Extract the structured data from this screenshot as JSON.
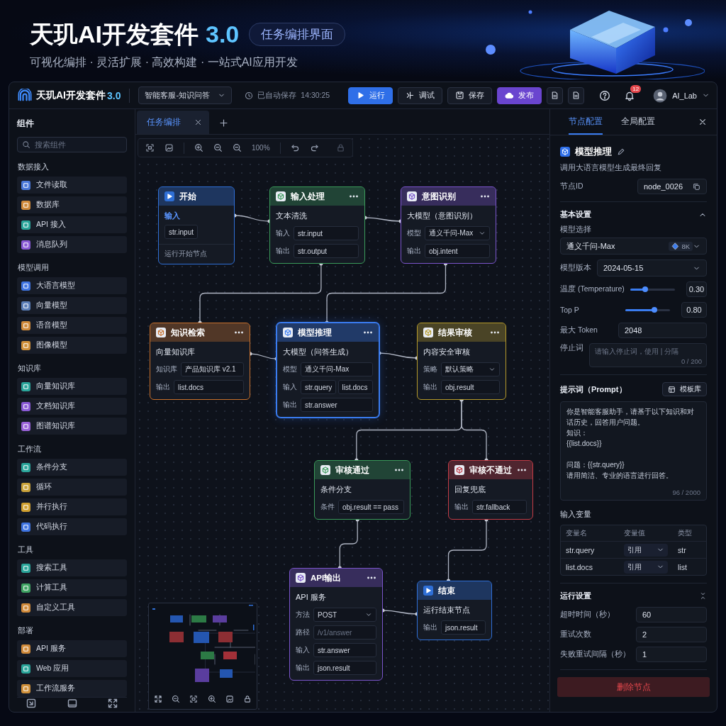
{
  "banner": {
    "title": "天玑AI开发套件",
    "version": "3.0",
    "tag": "任务编排界面",
    "subtitle": "可视化编排 · 灵活扩展 · 高效构建 · 一站式AI应用开发"
  },
  "topbar": {
    "app_name": "天玑AI开发套件",
    "version": "3.0",
    "project": "智能客服-知识问答",
    "autosave": "已自动保存  14:30:25",
    "buttons": [
      {
        "kind": "primary",
        "label": "运行"
      },
      {
        "kind": "secondary",
        "label": "调试"
      },
      {
        "kind": "secondary",
        "label": "保存"
      },
      {
        "kind": "publish",
        "label": "发布"
      }
    ],
    "notifications": "12",
    "user": "AI_Lab"
  },
  "sidebar": {
    "title": "组件",
    "search_placeholder": "搜索组件",
    "groups": [
      {
        "title": "数据接入",
        "items": [
          {
            "label": "文件读取",
            "color": "#4a78d8"
          },
          {
            "label": "数据库",
            "color": "#d08a3a"
          },
          {
            "label": "API 接入",
            "color": "#2aa59a"
          },
          {
            "label": "消息队列",
            "color": "#8a5ad6"
          }
        ]
      },
      {
        "title": "模型调用",
        "items": [
          {
            "label": "大语言模型",
            "color": "#3f74e0"
          },
          {
            "label": "向量模型",
            "color": "#5b7fb8"
          },
          {
            "label": "语音模型",
            "color": "#d08a3a"
          },
          {
            "label": "图像模型",
            "color": "#d0903a"
          }
        ]
      },
      {
        "title": "知识库",
        "items": [
          {
            "label": "向量知识库",
            "color": "#2aa59a"
          },
          {
            "label": "文档知识库",
            "color": "#8a5ad6"
          },
          {
            "label": "图谱知识库",
            "color": "#9a62d8"
          }
        ]
      },
      {
        "title": "工作流",
        "items": [
          {
            "label": "条件分支",
            "color": "#2aa59a"
          },
          {
            "label": "循环",
            "color": "#c9a23a"
          },
          {
            "label": "并行执行",
            "color": "#d0a030"
          },
          {
            "label": "代码执行",
            "color": "#3f74e0"
          }
        ]
      },
      {
        "title": "工具",
        "items": [
          {
            "label": "搜索工具",
            "color": "#2aa59a"
          },
          {
            "label": "计算工具",
            "color": "#3fa463"
          },
          {
            "label": "自定义工具",
            "color": "#d08a3a"
          }
        ]
      },
      {
        "title": "部署",
        "items": [
          {
            "label": "API 服务",
            "color": "#d08a3a"
          },
          {
            "label": "Web 应用",
            "color": "#2aa59a"
          },
          {
            "label": "工作流服务",
            "color": "#d0903a"
          }
        ]
      }
    ]
  },
  "tabs": [
    {
      "label": "任务编排",
      "selected": true
    }
  ],
  "canvas": {
    "zoom": "100%",
    "nodes": [
      {
        "kind": "start",
        "title": "开始",
        "color": "#2f6fd6",
        "selected": false,
        "input_label": "输入",
        "chip": "str.input",
        "footer": "运行开始节点"
      },
      {
        "kind": "step",
        "title": "输入处理",
        "color": "#3a9a5a",
        "selected": false,
        "subtitle": "文本清洗",
        "rows": [
          {
            "label": "输入",
            "kind": "field",
            "values": [
              "str.input"
            ]
          },
          {
            "label": "输出",
            "kind": "field",
            "values": [
              "str.output"
            ]
          }
        ]
      },
      {
        "kind": "step",
        "title": "意图识别",
        "color": "#7b55cc",
        "selected": false,
        "subtitle": "大模型（意图识别）",
        "rows": [
          {
            "label": "模型",
            "kind": "select",
            "values": [
              "通义千问-Max"
            ]
          },
          {
            "label": "输出",
            "kind": "field",
            "values": [
              "obj.intent"
            ]
          }
        ]
      },
      {
        "kind": "step",
        "title": "知识检索",
        "color": "#c8712c",
        "selected": false,
        "subtitle": "向量知识库",
        "rows": [
          {
            "label": "知识库",
            "kind": "field",
            "values": [
              "产品知识库 v2.1"
            ]
          },
          {
            "label": "输出",
            "kind": "field",
            "values": [
              "list.docs"
            ]
          }
        ]
      },
      {
        "kind": "step",
        "title": "模型推理",
        "color": "#3a7cf0",
        "selected": true,
        "subtitle": "大模型（问答生成）",
        "rows": [
          {
            "label": "模型",
            "kind": "field",
            "values": [
              "通义千问-Max"
            ]
          },
          {
            "label": "输入",
            "kind": "field",
            "values": [
              "str.query",
              "list.docs"
            ]
          },
          {
            "label": "输出",
            "kind": "field",
            "values": [
              "str.answer"
            ]
          }
        ]
      },
      {
        "kind": "step",
        "title": "结果审核",
        "color": "#b59a2a",
        "selected": false,
        "subtitle": "内容安全审核",
        "rows": [
          {
            "label": "策略",
            "kind": "select",
            "values": [
              "默认策略"
            ]
          },
          {
            "label": "输出",
            "kind": "field",
            "values": [
              "obj.result"
            ]
          }
        ]
      },
      {
        "kind": "step",
        "title": "审核通过",
        "color": "#3a9a5a",
        "selected": false,
        "subtitle": "条件分支",
        "rows": [
          {
            "label": "条件",
            "kind": "field",
            "values": [
              "obj.result == pass"
            ]
          }
        ]
      },
      {
        "kind": "step",
        "title": "审核不通过",
        "color": "#c43c46",
        "selected": false,
        "subtitle": "回复兜底",
        "rows": [
          {
            "label": "输出",
            "kind": "field",
            "values": [
              "str.fallback"
            ]
          }
        ]
      },
      {
        "kind": "step",
        "title": "API输出",
        "color": "#7b55cc",
        "selected": false,
        "subtitle": "API 服务",
        "rows": [
          {
            "label": "方法",
            "kind": "select",
            "values": [
              "POST"
            ]
          },
          {
            "label": "路径",
            "kind": "field",
            "placeholder": "/v1/answer"
          },
          {
            "label": "输入",
            "kind": "field",
            "values": [
              "str.answer"
            ]
          },
          {
            "label": "输出",
            "kind": "field",
            "values": [
              "json.result"
            ]
          }
        ]
      },
      {
        "kind": "end",
        "title": "结束",
        "color": "#2f6fd6",
        "selected": false,
        "subtitle": "运行结束节点",
        "rows": [
          {
            "label": "输出",
            "kind": "field",
            "values": [
              "json.result"
            ]
          }
        ]
      }
    ]
  },
  "panel": {
    "tabs": [
      {
        "label": "节点配置",
        "selected": true
      },
      {
        "label": "全局配置",
        "selected": false
      }
    ],
    "node_title": "模型推理",
    "node_desc": "调用大语言模型生成最终回复",
    "node_id_label": "节点ID",
    "node_id": "node_0026",
    "basic": {
      "title": "基本设置",
      "expanded": true,
      "model_label": "模型选择",
      "model": "通义千问-Max",
      "model_badge": "8K",
      "version_label": "模型版本",
      "version": "2024-05-15",
      "sliders": [
        {
          "label": "温度 (Temperature)",
          "level": 0.33,
          "reading": "0.30"
        },
        {
          "label": "Top P",
          "level": 0.65,
          "reading": "0.80"
        }
      ],
      "max_token_label": "最大 Token",
      "max_token": "2048",
      "stop_label": "停止词",
      "stop_placeholder": "请输入停止词，使用 | 分隔",
      "stop_count": "0 / 200"
    },
    "prompt": {
      "title": "提示词（Prompt）",
      "template_button": "模板库",
      "paragraphs": [
        [
          "你是智能客服助手，请基于以下知识和对话历史，回答用户问题。",
          "知识：",
          "{{list.docs}}"
        ],
        [
          "问题：{{str.query}}",
          "请用简洁、专业的语言进行回答。"
        ]
      ],
      "count": "96 / 2000"
    },
    "variables": {
      "title": "输入变量",
      "columns": [
        "变量名",
        "变量值",
        "类型"
      ],
      "rows": [
        {
          "name": "str.query",
          "value": "引用",
          "type": "str"
        },
        {
          "name": "list.docs",
          "value": "引用",
          "type": "list"
        }
      ]
    },
    "run": {
      "title": "运行设置",
      "fields": [
        {
          "label": "超时时间（秒）",
          "value": "60"
        },
        {
          "label": "重试次数",
          "value": "2"
        },
        {
          "label": "失败重试间隔（秒）",
          "value": "1"
        }
      ]
    },
    "delete_button": "删除节点"
  }
}
